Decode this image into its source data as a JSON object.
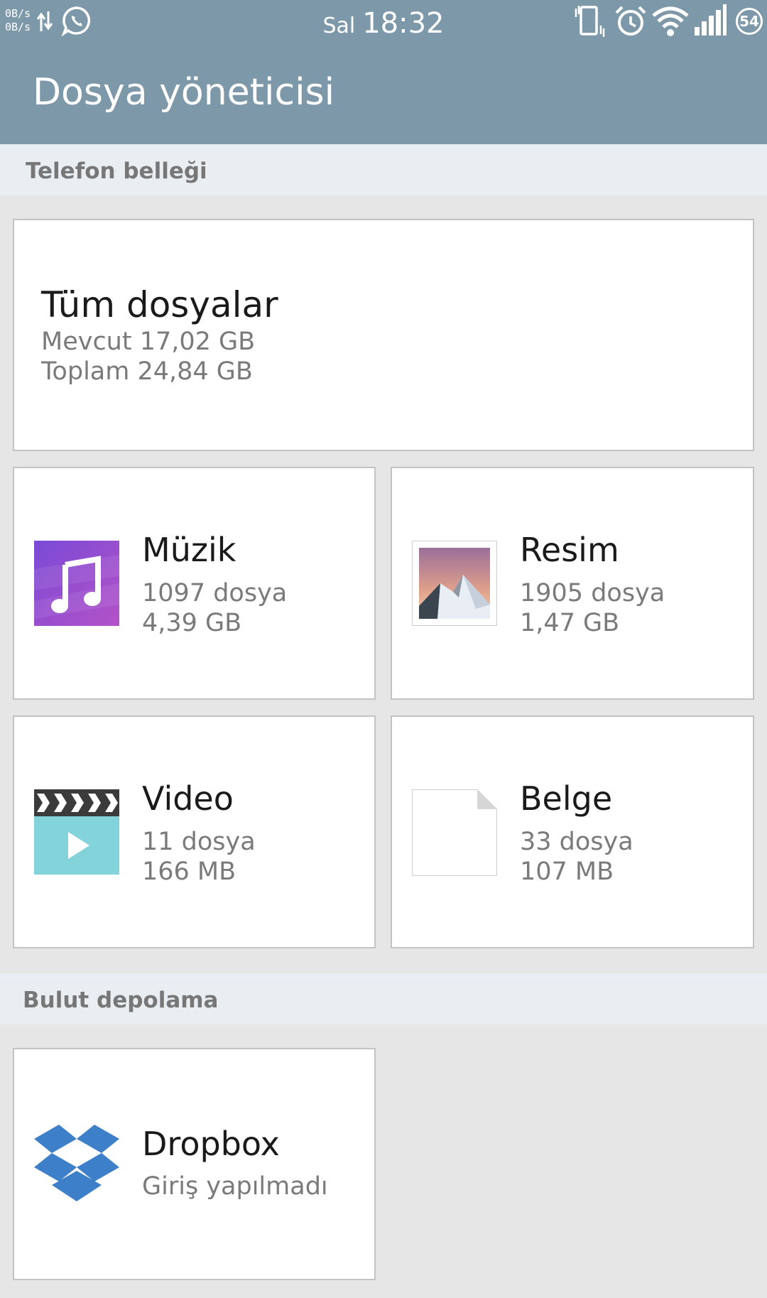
{
  "status_bar": {
    "net_up": "0B/s",
    "net_down": "0B/s",
    "day": "Sal",
    "time": "18:32",
    "battery": "54",
    "icons": [
      "data-arrows-icon",
      "whatsapp-icon",
      "vibrate-icon",
      "alarm-icon",
      "wifi-icon",
      "signal-icon",
      "battery-icon"
    ]
  },
  "app_bar": {
    "title": "Dosya yöneticisi"
  },
  "phone_storage": {
    "header": "Telefon belleği",
    "all_files": {
      "title": "Tüm dosyalar",
      "available": "Mevcut 17,02 GB",
      "total": "Toplam 24,84 GB"
    },
    "categories": [
      {
        "name": "Müzik",
        "count": "1097 dosya",
        "size": "4,39 GB",
        "icon": "music-icon"
      },
      {
        "name": "Resim",
        "count": "1905 dosya",
        "size": "1,47 GB",
        "icon": "image-icon"
      },
      {
        "name": "Video",
        "count": "11 dosya",
        "size": "166 MB",
        "icon": "video-icon"
      },
      {
        "name": "Belge",
        "count": "33 dosya",
        "size": "107 MB",
        "icon": "document-icon"
      }
    ]
  },
  "cloud_storage": {
    "header": "Bulut depolama",
    "services": [
      {
        "name": "Dropbox",
        "status": "Giriş yapılmadı",
        "icon": "dropbox-icon"
      }
    ]
  },
  "colors": {
    "app_bar": "#7d98a8",
    "section_header_bg": "#e8eef2",
    "background": "#e6e6e6",
    "dropbox_blue": "#3d7fc8",
    "music_purple": "#9b4fd0",
    "video_cyan": "#82d4da"
  }
}
